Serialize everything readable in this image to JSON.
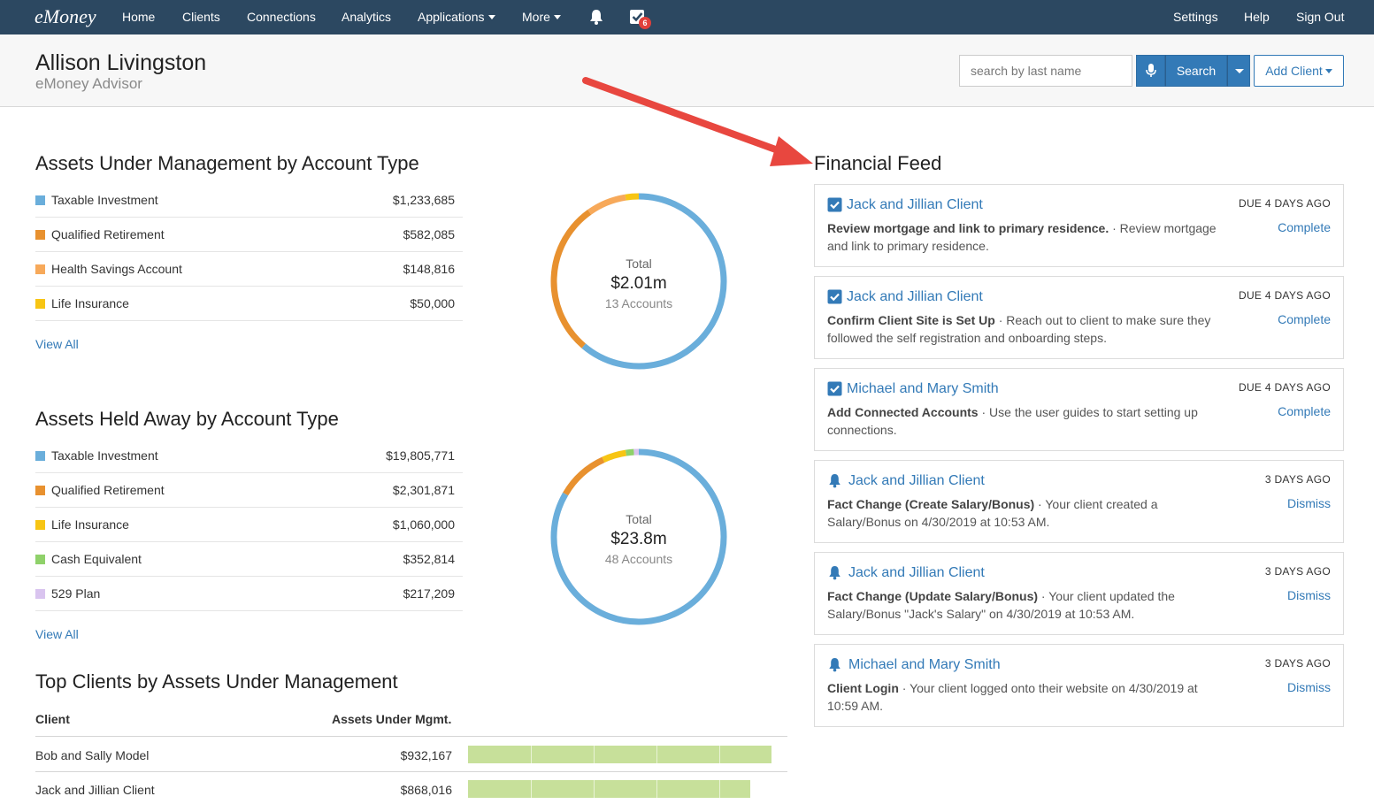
{
  "nav": {
    "brand": "eMoney",
    "items": [
      "Home",
      "Clients",
      "Connections",
      "Analytics",
      "Applications",
      "More"
    ],
    "right_items": [
      "Settings",
      "Help",
      "Sign Out"
    ],
    "tasks_badge": "6"
  },
  "header": {
    "user_name": "Allison Livingston",
    "user_role": "eMoney Advisor",
    "search_placeholder": "search by last name",
    "search_label": "Search",
    "add_client_label": "Add Client"
  },
  "aum": {
    "title": "Assets Under Management by Account Type",
    "rows": [
      {
        "name": "Taxable Investment",
        "value": "$1,233,685",
        "color": "#6aaedb"
      },
      {
        "name": "Qualified Retirement",
        "value": "$582,085",
        "color": "#e8912f"
      },
      {
        "name": "Health Savings Account",
        "value": "$148,816",
        "color": "#f7a95a"
      },
      {
        "name": "Life Insurance",
        "value": "$50,000",
        "color": "#f7c514"
      }
    ],
    "view_all": "View All",
    "donut": {
      "label": "Total",
      "total": "$2.01m",
      "accounts": "13 Accounts"
    }
  },
  "held_away": {
    "title": "Assets Held Away by Account Type",
    "rows": [
      {
        "name": "Taxable Investment",
        "value": "$19,805,771",
        "color": "#6aaedb"
      },
      {
        "name": "Qualified Retirement",
        "value": "$2,301,871",
        "color": "#e8912f"
      },
      {
        "name": "Life Insurance",
        "value": "$1,060,000",
        "color": "#f7c514"
      },
      {
        "name": "Cash Equivalent",
        "value": "$352,814",
        "color": "#8fd16a"
      },
      {
        "name": "529 Plan",
        "value": "$217,209",
        "color": "#d9c4ef"
      }
    ],
    "view_all": "View All",
    "donut": {
      "label": "Total",
      "total": "$23.8m",
      "accounts": "48 Accounts"
    }
  },
  "chart_data": [
    {
      "type": "pie",
      "categories": [
        "Taxable Investment",
        "Qualified Retirement",
        "Health Savings Account",
        "Life Insurance"
      ],
      "values": [
        1233685,
        582085,
        148816,
        50000
      ]
    },
    {
      "type": "pie",
      "categories": [
        "Taxable Investment",
        "Qualified Retirement",
        "Life Insurance",
        "Cash Equivalent",
        "529 Plan"
      ],
      "values": [
        19805771,
        2301871,
        1060000,
        352814,
        217209
      ]
    },
    {
      "type": "bar",
      "categories": [
        "Bob and Sally Model",
        "Jack and Jillian Client"
      ],
      "values": [
        932167,
        868016
      ],
      "xlim": [
        0,
        1000000
      ]
    }
  ],
  "top_clients": {
    "title": "Top Clients by Assets Under Management",
    "col_client": "Client",
    "col_assets": "Assets Under Mgmt.",
    "rows": [
      {
        "name": "Bob and Sally Model",
        "value": "$932,167"
      },
      {
        "name": "Jack and Jillian Client",
        "value": "$868,016"
      }
    ]
  },
  "feed": {
    "title": "Financial Feed",
    "items": [
      {
        "icon": "checkbox-icon",
        "client": "Jack and Jillian Client",
        "due": "DUE 4 DAYS AGO",
        "bold": "Review mortgage and link to primary residence.",
        "text": " · Review mortgage and link to primary residence.",
        "action": "Complete"
      },
      {
        "icon": "checkbox-icon",
        "client": "Jack and Jillian Client",
        "due": "DUE 4 DAYS AGO",
        "bold": "Confirm Client Site is Set Up",
        "text": " · Reach out to client to make sure they followed the self registration and onboarding steps.",
        "action": "Complete"
      },
      {
        "icon": "checkbox-icon",
        "client": "Michael and Mary Smith",
        "due": "DUE 4 DAYS AGO",
        "bold": "Add Connected Accounts",
        "text": " · Use the user guides to start setting up connections.",
        "action": "Complete"
      },
      {
        "icon": "bell-icon",
        "client": "Jack and Jillian Client",
        "due": "3 DAYS AGO",
        "bold": "Fact Change (Create Salary/Bonus)",
        "text": " · Your client created a Salary/Bonus on 4/30/2019 at 10:53 AM.",
        "action": "Dismiss"
      },
      {
        "icon": "bell-icon",
        "client": "Jack and Jillian Client",
        "due": "3 DAYS AGO",
        "bold": "Fact Change (Update Salary/Bonus)",
        "text": " · Your client updated the Salary/Bonus \"Jack's Salary\" on 4/30/2019 at 10:53 AM.",
        "action": "Dismiss"
      },
      {
        "icon": "bell-icon",
        "client": "Michael and Mary Smith",
        "due": "3 DAYS AGO",
        "bold": "Client Login",
        "text": " · Your client logged onto their website on 4/30/2019 at 10:59 AM.",
        "action": "Dismiss"
      }
    ]
  },
  "colors": {
    "nav_bg": "#2c4861",
    "link": "#337ab7",
    "annotation_arrow": "#e8473f",
    "bar": "#c7e09a"
  }
}
